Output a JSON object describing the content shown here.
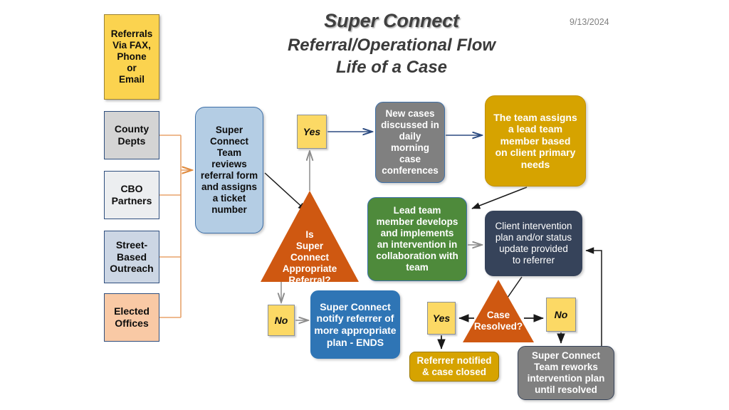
{
  "header": {
    "title": "Super Connect",
    "subtitle_line1": "Referral/Operational Flow",
    "subtitle_line2": "Life of a Case",
    "date": "9/13/2024"
  },
  "sources": {
    "referrals": "Referrals\nVia FAX,\nPhone\nor\nEmail",
    "items": [
      {
        "id": "county-depts",
        "label": "County\nDepts"
      },
      {
        "id": "cbo-partners",
        "label": "CBO\nPartners"
      },
      {
        "id": "street-based-outreach",
        "label": "Street-\nBased\nOutreach"
      },
      {
        "id": "elected-offices",
        "label": "Elected\nOffices"
      }
    ]
  },
  "flow": {
    "team_review": "Super\nConnect\nTeam\nreviews\nreferral form\nand assigns\na ticket\nnumber",
    "decision_referral": "Is\nSuper\nConnect\nAppropriate\nReferral?",
    "new_cases": "New cases\ndiscussed in\ndaily\nmorning\ncase\nconferences",
    "team_assigns_lead": "The team assigns\na lead team\nmember based\non client primary\nneeds",
    "lead_member_intervention": "Lead team\nmember  develops\nand implements\nan intervention in\ncollaboration with\nteam",
    "client_intervention_plan": "Client intervention\nplan and/or status\nupdate  provided\nto referrer",
    "notify_referrer_ends": "Super Connect\nnotify referrer of\nmore appropriate\nplan - ENDS",
    "decision_resolved": "Case\nResolved?",
    "referrer_notified_closed": "Referrer notified\n& case closed",
    "team_reworks": "Super Connect\nTeam  reworks\nintervention plan\nuntil resolved"
  },
  "labels": {
    "yes_referral": "Yes",
    "no_referral": "No",
    "yes_resolved": "Yes",
    "no_resolved": "No"
  },
  "colors": {
    "referrals_yellow": "#fbd34f",
    "county_gray": "#d4d4d4",
    "cbo_light": "#eceef0",
    "street_blue_gray": "#ccd6e4",
    "elected_peach": "#f9c9a5",
    "team_blue": "#b4cde4",
    "triangle_orange": "#cf5811",
    "new_cases_gray": "#808080",
    "assigns_gold": "#d6a300",
    "lead_green": "#4e8a3b",
    "client_navy": "#36435a",
    "notify_blue": "#2f75b5",
    "chip_yellow": "#fcd965",
    "connector_orange": "#e8a36c",
    "connector_dark": "#1a1a1a"
  }
}
